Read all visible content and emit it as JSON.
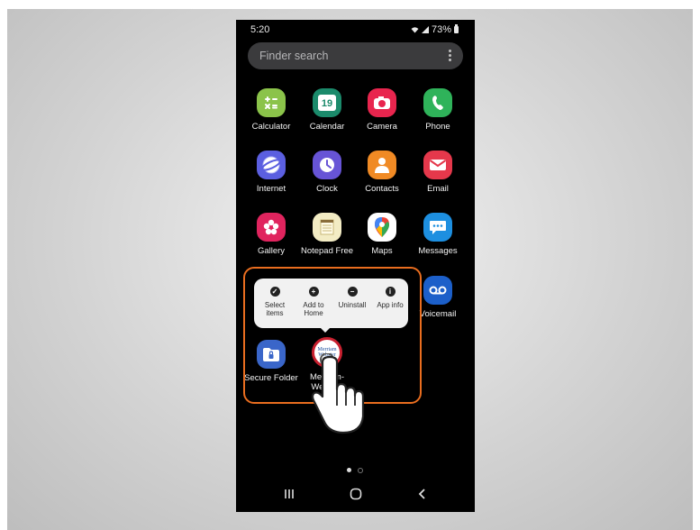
{
  "status_bar": {
    "time": "5:20",
    "battery": "73%"
  },
  "search": {
    "placeholder": "Finder search"
  },
  "apps": [
    {
      "label": "Calculator",
      "icon": "calculator-icon",
      "color": "#8bc34a"
    },
    {
      "label": "Calendar",
      "icon": "calendar-icon",
      "color": "#1b8a6b",
      "day": "19"
    },
    {
      "label": "Camera",
      "icon": "camera-icon",
      "color": "#e8254e"
    },
    {
      "label": "Phone",
      "icon": "phone-icon",
      "color": "#2fb35a"
    },
    {
      "label": "Internet",
      "icon": "internet-icon",
      "color": "#5b5fe0"
    },
    {
      "label": "Clock",
      "icon": "clock-icon",
      "color": "#6754d6"
    },
    {
      "label": "Contacts",
      "icon": "contacts-icon",
      "color": "#f08a24"
    },
    {
      "label": "Email",
      "icon": "email-icon",
      "color": "#e5384b"
    },
    {
      "label": "Gallery",
      "icon": "gallery-icon",
      "color": "#e0245e"
    },
    {
      "label": "Notepad Free",
      "icon": "notepad-icon",
      "color": "#f3ecc4"
    },
    {
      "label": "Maps",
      "icon": "maps-icon",
      "color": "#ffffff"
    },
    {
      "label": "Messages",
      "icon": "messages-icon",
      "color": "#1d8fe0"
    },
    {
      "label": "Voicemail",
      "icon": "voicemail-icon",
      "color": "#1c5fc9"
    },
    {
      "label": "Secure Folder",
      "icon": "secure-folder-icon",
      "color": "#3a66c9"
    },
    {
      "label": "Merriam-Webster",
      "icon": "merriam-webster-icon",
      "color": "#ffffff",
      "logo_text": "Merriam Webster"
    }
  ],
  "context_menu": [
    {
      "label": "Select items",
      "icon": "check-circle-icon"
    },
    {
      "label": "Add to Home",
      "icon": "add-home-icon"
    },
    {
      "label": "Uninstall",
      "icon": "minus-circle-icon"
    },
    {
      "label": "App info",
      "icon": "info-circle-icon"
    }
  ],
  "colors": {
    "highlight": "#e96d1f"
  }
}
